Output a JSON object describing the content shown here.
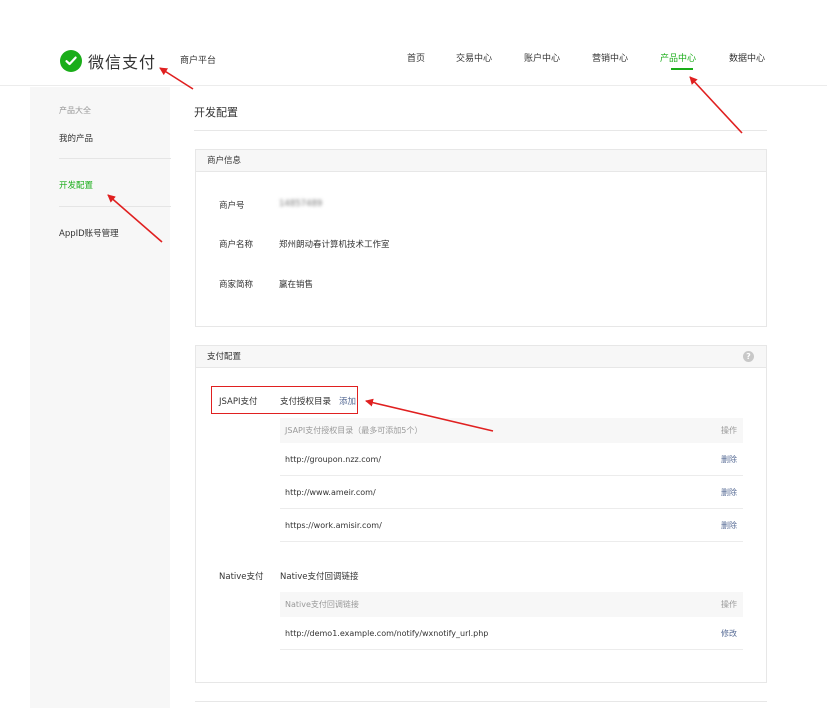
{
  "brand": {
    "name": "微信支付",
    "platform": "商户平台"
  },
  "nav": [
    {
      "label": "首页",
      "active": false
    },
    {
      "label": "交易中心",
      "active": false
    },
    {
      "label": "账户中心",
      "active": false
    },
    {
      "label": "营销中心",
      "active": false
    },
    {
      "label": "产品中心",
      "active": true
    },
    {
      "label": "数据中心",
      "active": false
    }
  ],
  "sidebar": {
    "group_label": "产品大全",
    "items": [
      {
        "label": "我的产品",
        "active": false
      },
      {
        "label": "开发配置",
        "active": true
      },
      {
        "label": "AppID账号管理",
        "active": false
      }
    ]
  },
  "page": {
    "title": "开发配置"
  },
  "merchant_info": {
    "heading": "商户信息",
    "rows": [
      {
        "label": "商户号",
        "value": "14857489"
      },
      {
        "label": "商户名称",
        "value": "郑州朗动春计算机技术工作室"
      },
      {
        "label": "商家简称",
        "value": "赢在销售"
      }
    ]
  },
  "payment_config": {
    "heading": "支付配置",
    "help_icon": "?",
    "jsapi": {
      "label": "JSAPI支付",
      "dir_label": "支付授权目录",
      "add_label": "添加",
      "table_header": "JSAPI支付授权目录（最多可添加5个）",
      "op_header": "操作",
      "rows": [
        {
          "url": "http://groupon.nzz.com/",
          "action": "删除"
        },
        {
          "url": "http://www.ameir.com/",
          "action": "删除"
        },
        {
          "url": "https://work.amisir.com/",
          "action": "删除"
        }
      ]
    },
    "native": {
      "label": "Native支付",
      "dir_label": "Native支付回调链接",
      "table_header": "Native支付回调链接",
      "op_header": "操作",
      "rows": [
        {
          "url": "http://demo1.example.com/notify/wxnotify_url.php",
          "action": "修改"
        }
      ]
    }
  },
  "colors": {
    "accent": "#1aad19",
    "link": "#576b95",
    "annotation": "#e02020"
  }
}
